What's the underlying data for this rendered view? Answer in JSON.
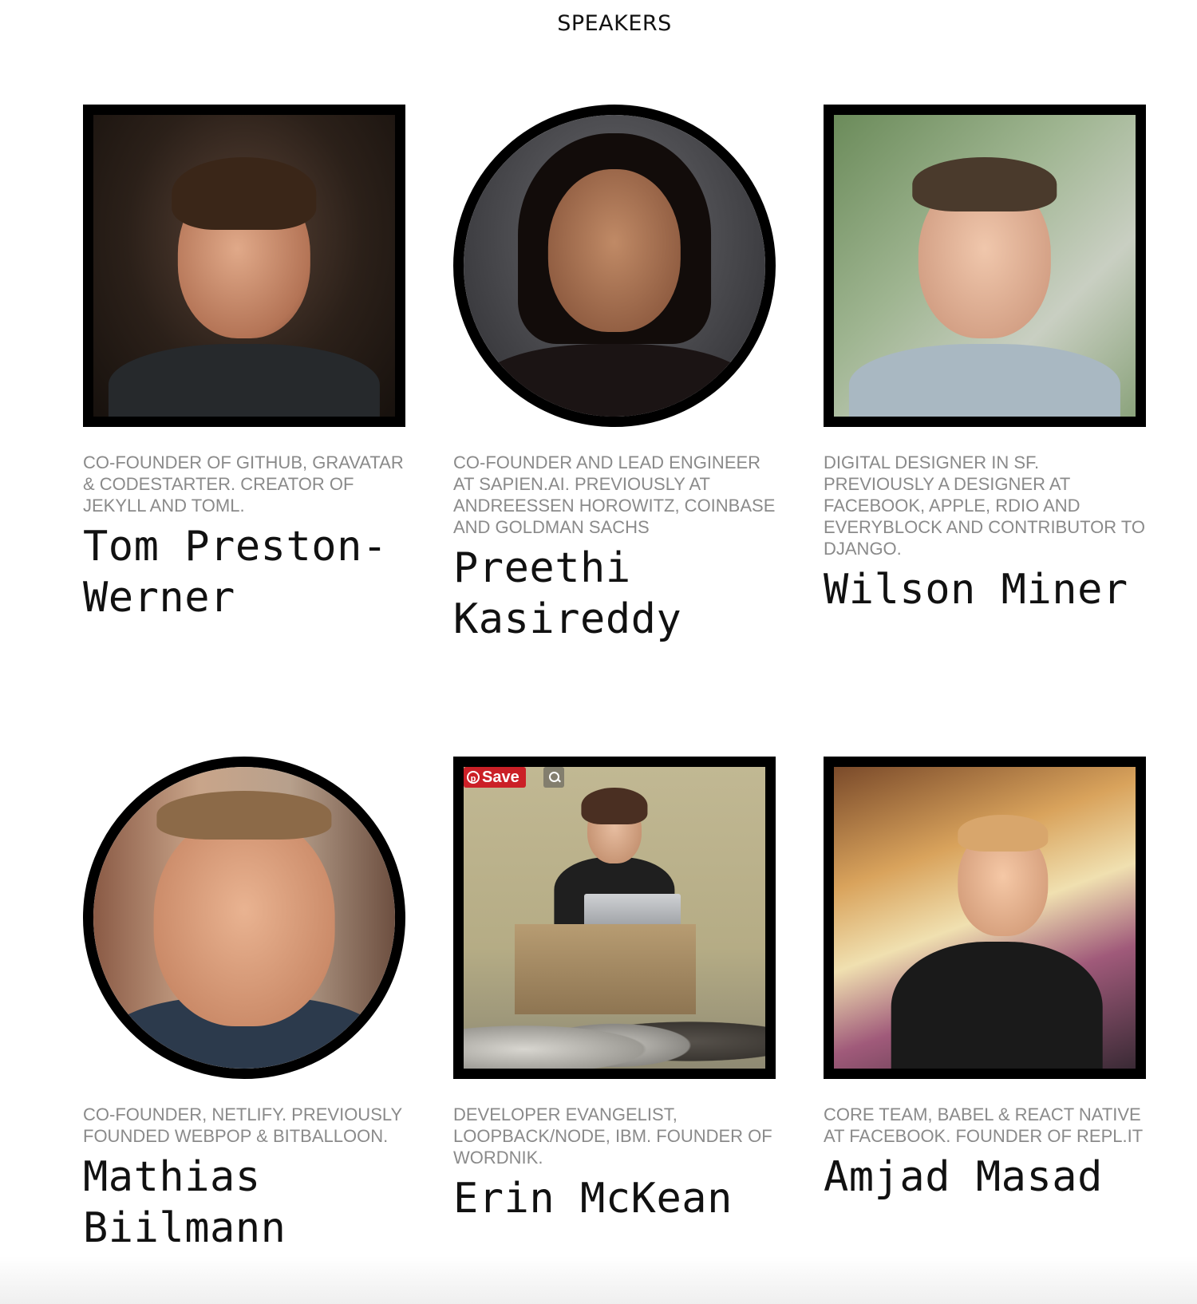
{
  "page": {
    "heading": "SPEAKERS"
  },
  "speakers": [
    {
      "name": "Tom Preston-Werner",
      "bio": "CO-FOUNDER OF GITHUB, GRAVATAR & CODESTARTER. CREATOR OF JEKYLL AND TOML.",
      "photo_shape": "square"
    },
    {
      "name": "Preethi Kasireddy",
      "bio": "CO-FOUNDER AND LEAD ENGINEER AT SAPIEN.AI. PREVIOUSLY AT ANDREESSEN HOROWITZ, COINBASE AND GOLDMAN SACHS",
      "photo_shape": "circle"
    },
    {
      "name": "Wilson Miner",
      "bio": "DIGITAL DESIGNER IN SF. PREVIOUSLY A DESIGNER AT FACEBOOK, APPLE, RDIO AND EVERYBLOCK AND CONTRIBUTOR TO DJANGO.",
      "photo_shape": "square"
    },
    {
      "name": "Mathias Biilmann",
      "bio": "CO-FOUNDER, NETLIFY. PREVIOUSLY FOUNDED WEBPOP & BITBALLOON.",
      "photo_shape": "circle"
    },
    {
      "name": "Erin McKean",
      "bio": "DEVELOPER EVANGELIST, LOOPBACK/NODE, IBM. FOUNDER OF WORDNIK.",
      "photo_shape": "square",
      "overlay": {
        "save_label": "Save",
        "save_icon": "pinterest-icon",
        "lens_icon": "visual-search-icon"
      }
    },
    {
      "name": "Amjad Masad",
      "bio": "CORE TEAM, BABEL & REACT NATIVE AT FACEBOOK. FOUNDER OF REPL.IT",
      "photo_shape": "square"
    }
  ]
}
